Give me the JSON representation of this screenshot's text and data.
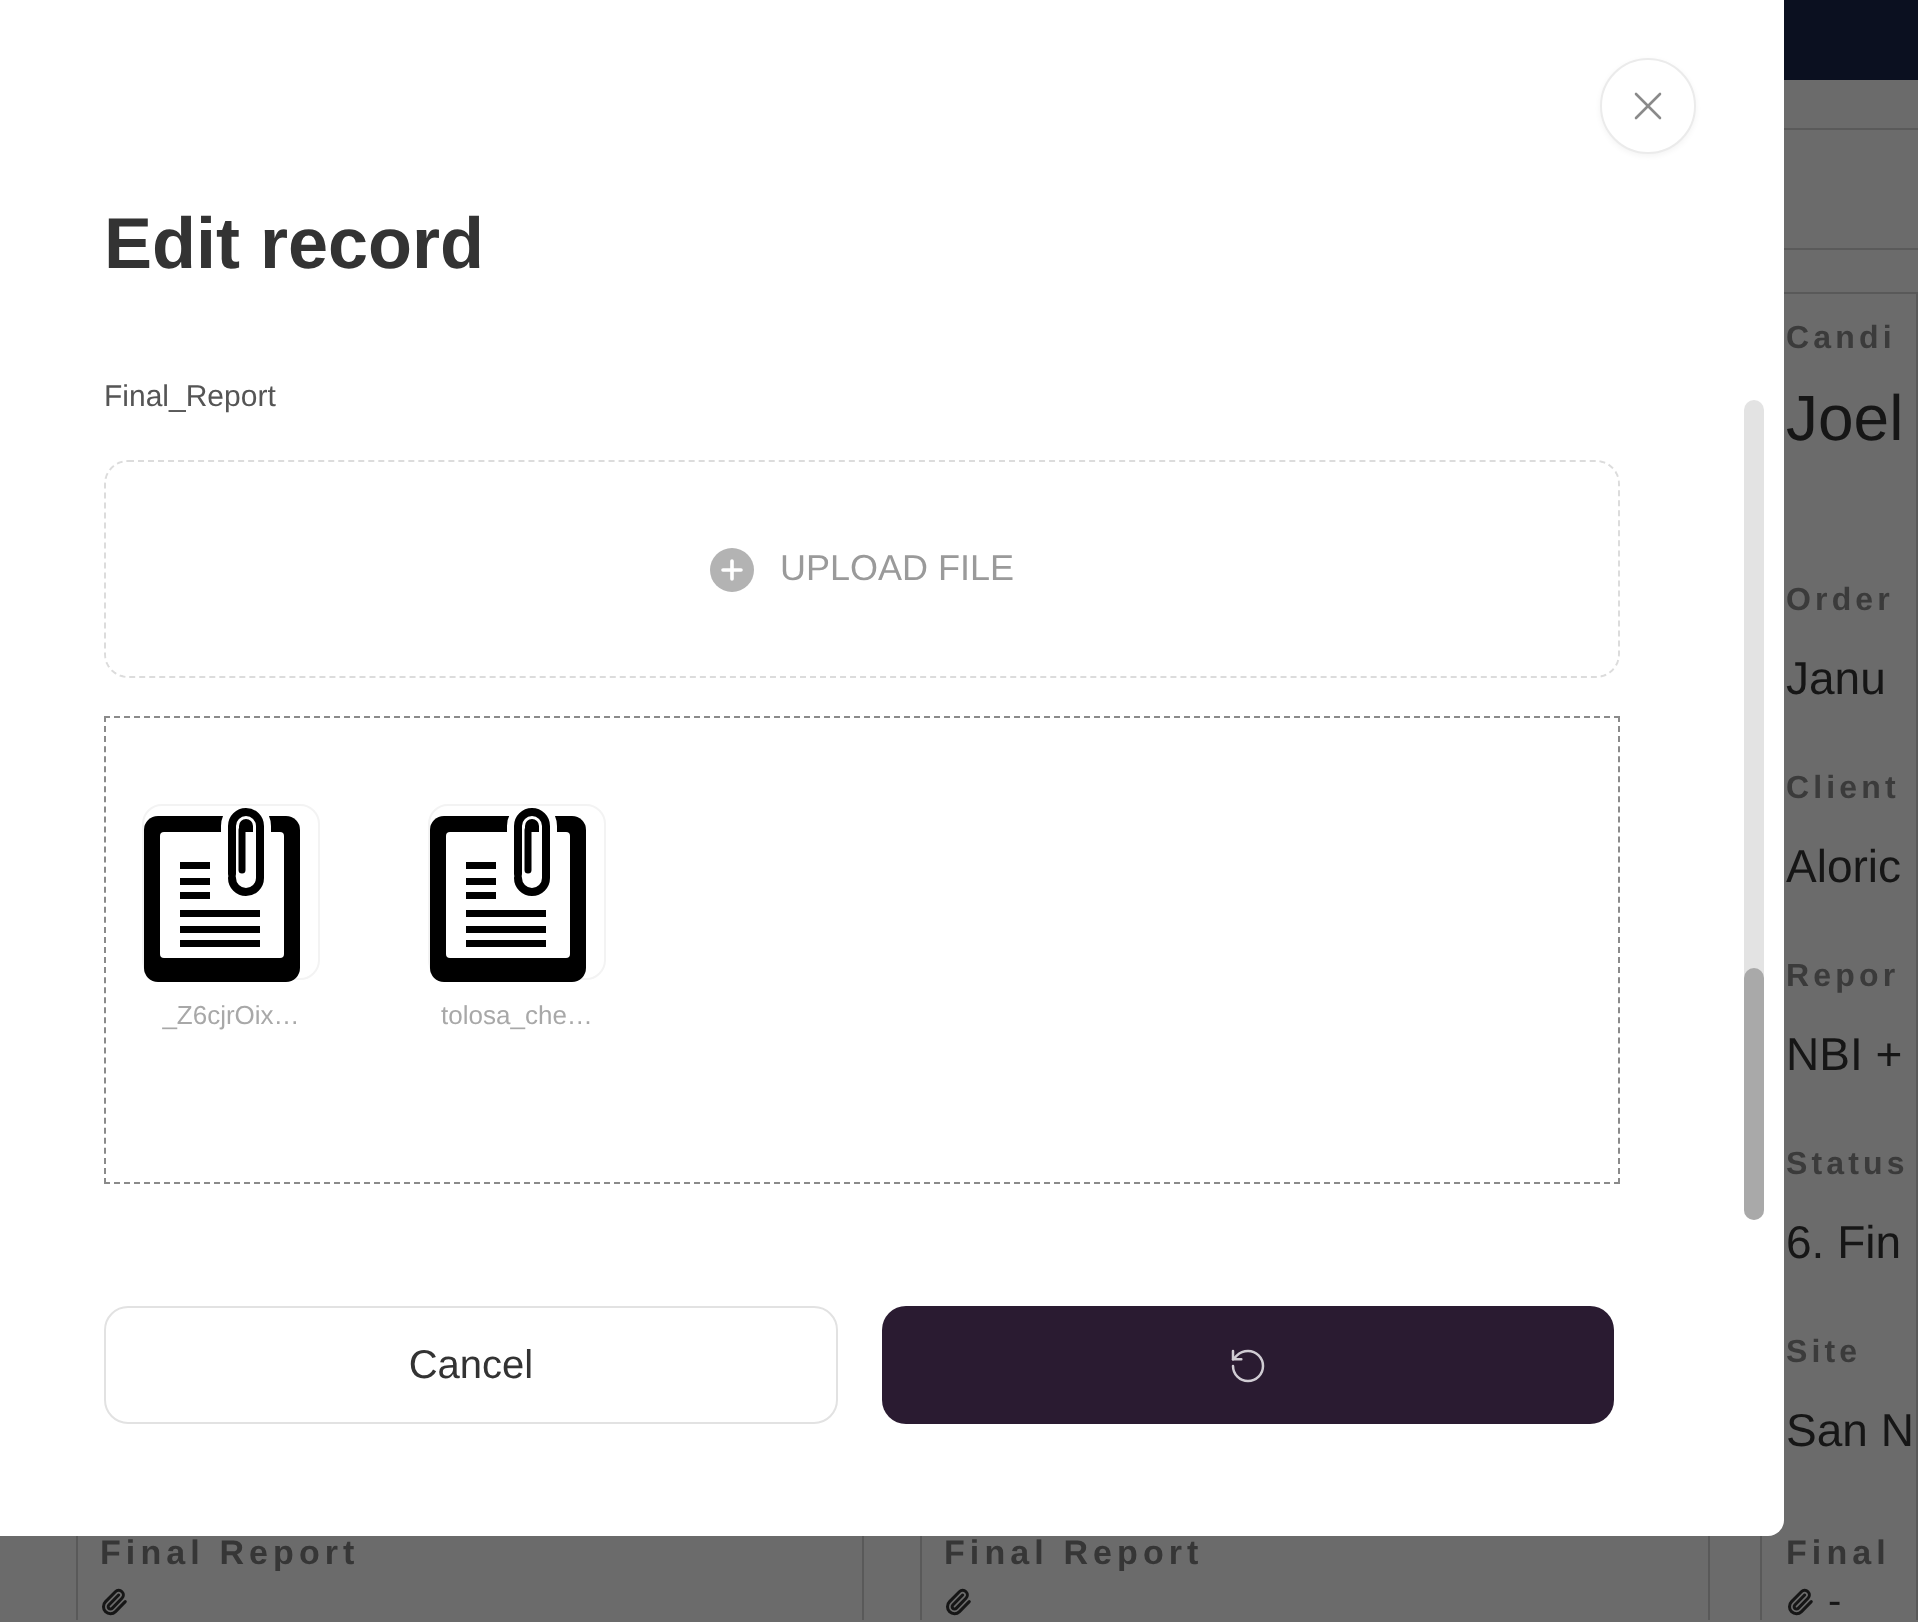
{
  "dialog": {
    "title": "Edit record",
    "field_label": "Final_Report",
    "upload_button": {
      "label": "UPLOAD FILE"
    },
    "files": [
      {
        "name": "_Z6cjrOix…"
      },
      {
        "name": "tolosa_che…"
      }
    ],
    "actions": {
      "cancel": {
        "label": "Cancel"
      },
      "submit": {
        "loading": true
      }
    }
  },
  "background_page": {
    "cards": [
      {
        "final_label": "Final Report"
      },
      {
        "final_label": "Final Report"
      },
      {
        "candidate": {
          "label": "Candi",
          "value": "Joel"
        },
        "fields": [
          {
            "label": "Order",
            "value": "Janu"
          },
          {
            "label": "Client",
            "value": "Aloric"
          },
          {
            "label": "Repor",
            "value": "NBI +"
          },
          {
            "label": "Status",
            "value": "6. Fin"
          },
          {
            "label": "Site",
            "value": "San N"
          }
        ],
        "final_label": "Final",
        "final_value": "-"
      }
    ]
  }
}
